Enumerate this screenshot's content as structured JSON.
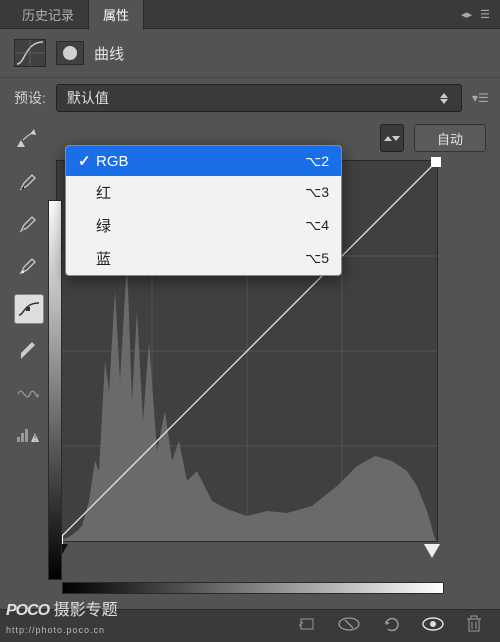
{
  "tabs": {
    "history": "历史记录",
    "properties": "属性"
  },
  "title": "曲线",
  "preset": {
    "label": "预设:",
    "value": "默认值"
  },
  "channel_dropdown": {
    "items": [
      {
        "label": "RGB",
        "shortcut": "⌥2",
        "selected": true
      },
      {
        "label": "红",
        "shortcut": "⌥3",
        "selected": false
      },
      {
        "label": "绿",
        "shortcut": "⌥4",
        "selected": false
      },
      {
        "label": "蓝",
        "shortcut": "⌥5",
        "selected": false
      }
    ]
  },
  "auto_label": "自动",
  "watermark": {
    "brand": "POCO",
    "text": "摄影专题",
    "url": "http://photo.poco.cn"
  }
}
